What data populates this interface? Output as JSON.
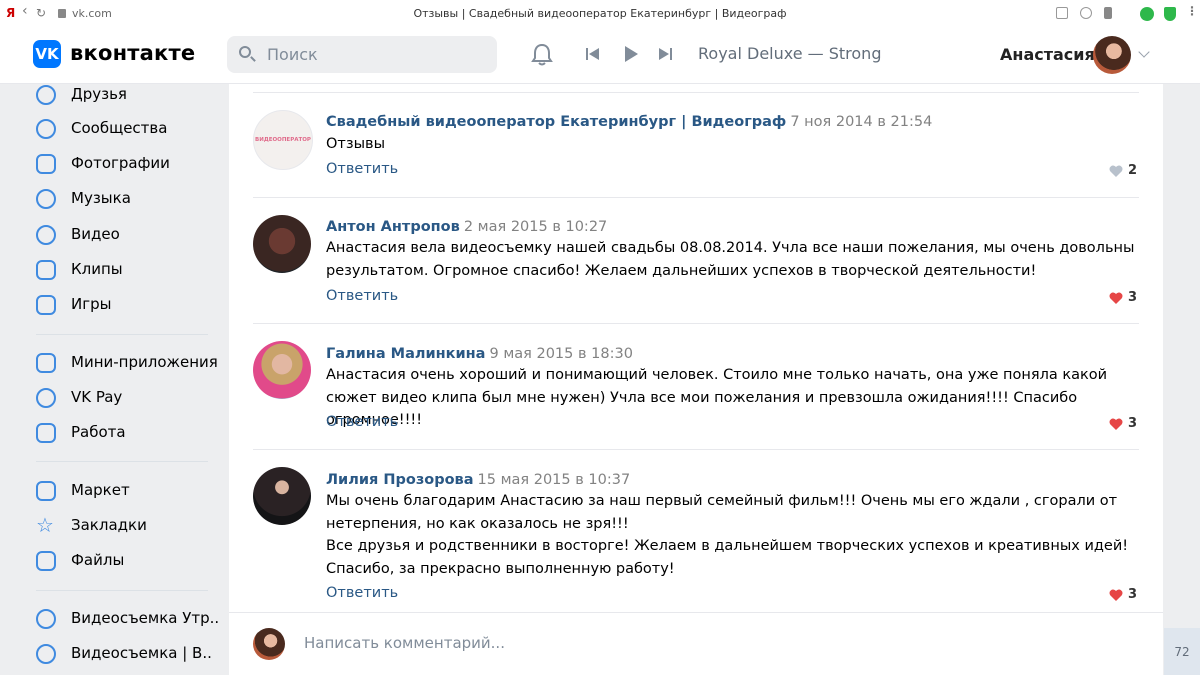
{
  "browser": {
    "logo_glyph": "Я",
    "back_glyph": "‹",
    "reload_glyph": "↻",
    "url": "vk.com",
    "tab_title": "Отзывы | Свадебный видеооператор Екатеринбург | Видеограф"
  },
  "header": {
    "logo_letters": "VK",
    "logo_text": "вконтакте",
    "search_placeholder": "Поиск",
    "track": "Royal Deluxe — Strong",
    "user_name": "Анастасия"
  },
  "sidebar": {
    "items": [
      {
        "label": "Друзья",
        "icon": "friends-icon"
      },
      {
        "label": "Сообщества",
        "icon": "communities-icon"
      },
      {
        "label": "Фотографии",
        "icon": "photos-icon"
      },
      {
        "label": "Музыка",
        "icon": "music-icon"
      },
      {
        "label": "Видео",
        "icon": "video-icon"
      },
      {
        "label": "Клипы",
        "icon": "clips-icon"
      },
      {
        "label": "Игры",
        "icon": "games-icon"
      },
      {
        "label": "Мини-приложения",
        "icon": "mini-apps-icon"
      },
      {
        "label": "VK Pay",
        "icon": "vkpay-icon"
      },
      {
        "label": "Работа",
        "icon": "work-icon"
      },
      {
        "label": "Маркет",
        "icon": "market-icon"
      },
      {
        "label": "Закладки",
        "icon": "bookmarks-icon"
      },
      {
        "label": "Файлы",
        "icon": "files-icon"
      },
      {
        "label": "Видеосъемка Утр..",
        "icon": "group-icon"
      },
      {
        "label": "Видеосъемка | В..",
        "icon": "group-icon"
      }
    ]
  },
  "comments": [
    {
      "author": "Свадебный видеооператор Екатеринбург | Видеограф",
      "date": "7 ноя 2014 в 21:54",
      "text": "Отзывы",
      "reply": "Ответить",
      "likes": "2",
      "avatar_text": "ВИДЕООПЕРАТОР"
    },
    {
      "author": "Антон Антропов",
      "date": "2 мая 2015 в 10:27",
      "text": "Анастасия вела видеосъемку нашей свадьбы 08.08.2014. Учла все наши пожелания, мы очень довольны результатом. Огромное спасибо! Желаем дальнейших успехов в творческой деятельности!",
      "reply": "Ответить",
      "likes": "3"
    },
    {
      "author": "Галина Малинкина",
      "date": "9 мая 2015 в 18:30",
      "text": "Анастасия очень хороший и понимающий человек. Стоило мне только начать, она уже поняла какой сюжет видео клипа был мне нужен) Учла все мои пожелания и превзошла ожидания!!!! Спасибо огромное!!!!",
      "reply": "Ответить",
      "likes": "3"
    },
    {
      "author": "Лилия Прозорова",
      "date": "15 мая 2015 в 10:37",
      "text": "Мы очень благодарим Анастасию за наш первый семейный фильм!!! Очень мы его ждали , сгорали от нетерпения, но как оказалось не зря!!!\nВсе друзья и родственники в восторге! Желаем в дальнейшем творческих успехов и креативных идей! Спасибо, за прекрасно выполненную работу!",
      "reply": "Ответить",
      "likes": "3"
    }
  ],
  "composer": {
    "placeholder": "Написать комментарий..."
  },
  "counter": "72",
  "colors": {
    "vk_blue": "#0077ff",
    "link": "#2a5885",
    "icon_blue": "#3f8ae0",
    "like_red": "#e64646",
    "like_grey": "#b8c1cc"
  }
}
